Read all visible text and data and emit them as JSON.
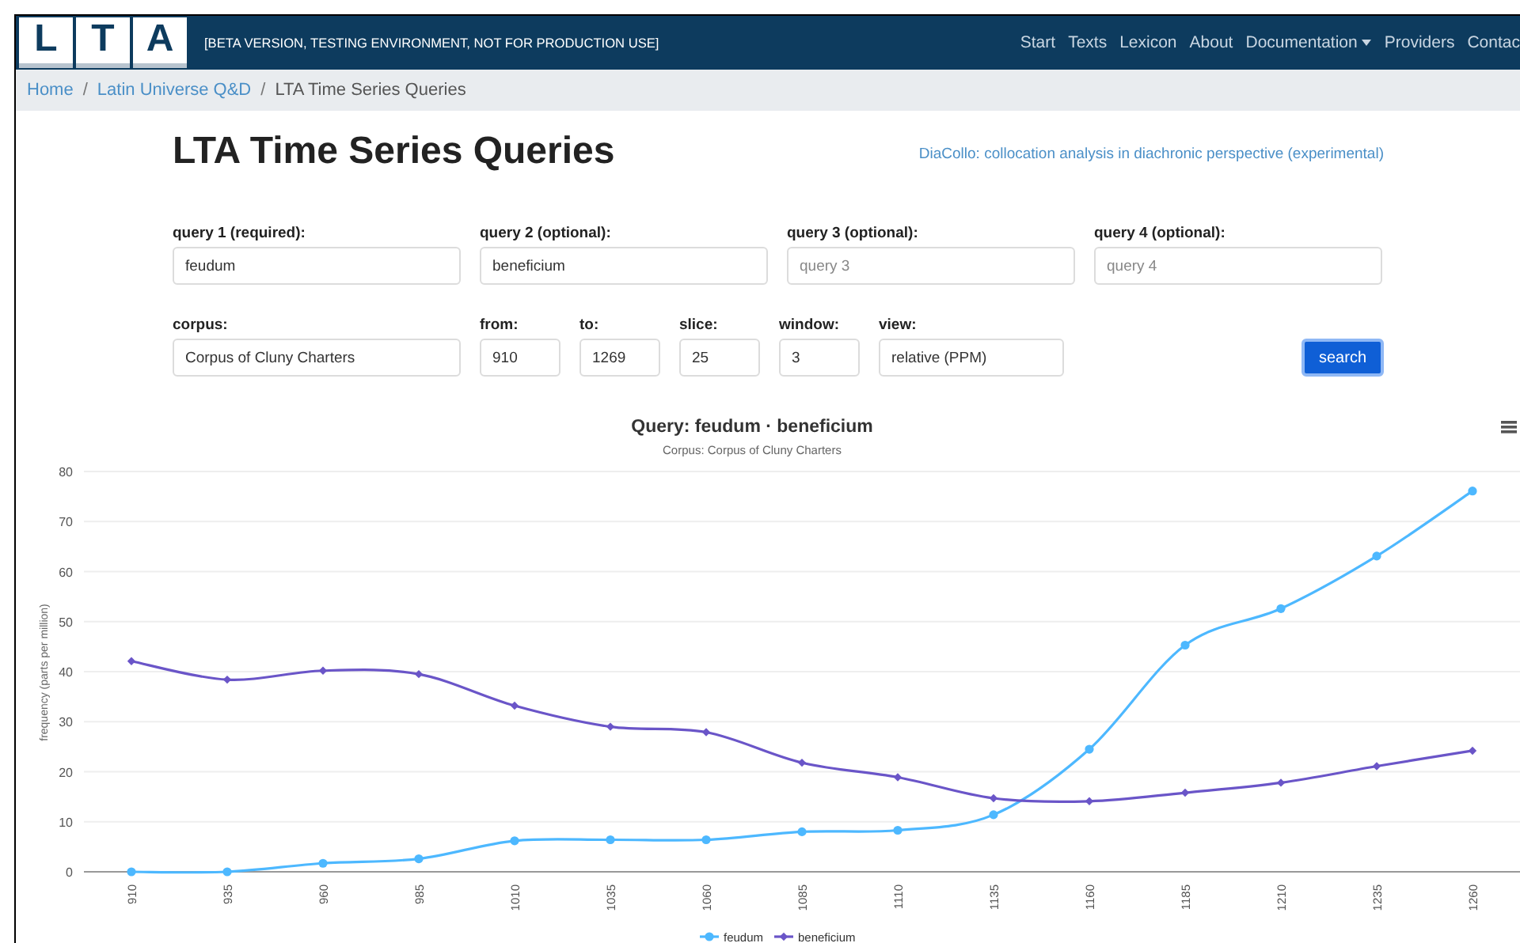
{
  "logo": {
    "letters": [
      "L",
      "T",
      "A"
    ]
  },
  "banner": "[BETA VERSION, TESTING ENVIRONMENT, NOT FOR PRODUCTION USE]",
  "nav": [
    {
      "label": "Start",
      "kind": "link"
    },
    {
      "label": "Texts",
      "kind": "link"
    },
    {
      "label": "Lexicon",
      "kind": "link"
    },
    {
      "label": "About",
      "kind": "link"
    },
    {
      "label": "Documentation",
      "kind": "dropdown"
    },
    {
      "label": "Providers",
      "kind": "link"
    },
    {
      "label": "Contac",
      "kind": "link"
    }
  ],
  "breadcrumb_separator": "/",
  "breadcrumb": [
    {
      "label": "Home",
      "kind": "link"
    },
    {
      "label": "Latin Universe Q&D",
      "kind": "link"
    },
    {
      "label": "LTA Time Series Queries",
      "kind": "current"
    }
  ],
  "title": "LTA Time Series Queries",
  "side_link": "DiaCollo: collocation analysis in diachronic perspective (experimental)",
  "query_fields": [
    {
      "label": "query 1 (required):",
      "value": "feudum"
    },
    {
      "label": "query 2 (optional):",
      "value": "beneficium"
    },
    {
      "label": "query 3 (optional):",
      "placeholder": "query 3"
    },
    {
      "label": "query 4 (optional):",
      "placeholder": "query 4"
    }
  ],
  "option_fields": [
    {
      "label": "corpus:",
      "value": "Corpus of Cluny Charters",
      "kind": "wide"
    },
    {
      "label": "from:",
      "value": "910",
      "kind": "narrow"
    },
    {
      "label": "to:",
      "value": "1269",
      "kind": "narrow"
    },
    {
      "label": "slice:",
      "value": "25",
      "kind": "narrow"
    },
    {
      "label": "window:",
      "value": "3",
      "kind": "narrow"
    },
    {
      "label": "view:",
      "value": "relative (PPM)",
      "kind": "medium"
    }
  ],
  "search_button": "search",
  "chart": {
    "subtitle": "Corpus: Corpus of Cluny Charters",
    "chart_data": {
      "type": "line",
      "grid": true,
      "legend": "bottom",
      "title": "Query: feudum · beneficium",
      "ylabel": "frequency (parts per million)",
      "categories": [
        "910",
        "935",
        "960",
        "985",
        "1010",
        "1035",
        "1060",
        "1085",
        "1110",
        "1135",
        "1160",
        "1185",
        "1210",
        "1235",
        "1260"
      ],
      "ylim": [
        0,
        80
      ],
      "yticks": [
        0,
        10,
        20,
        30,
        40,
        50,
        60,
        70,
        80
      ],
      "series": [
        {
          "name": "feudum",
          "color": "#4db8ff",
          "marker": "circle",
          "values": [
            0,
            0,
            1.7,
            2.6,
            6.2,
            6.4,
            6.4,
            8.0,
            8.3,
            11.4,
            24.5,
            45.3,
            52.6,
            63.1,
            76.1
          ]
        },
        {
          "name": "beneficium",
          "color": "#6a55c8",
          "marker": "diamond",
          "values": [
            42.1,
            38.4,
            40.2,
            39.5,
            33.2,
            29.0,
            27.9,
            21.8,
            18.9,
            14.7,
            14.1,
            15.8,
            17.8,
            21.1,
            24.2
          ]
        }
      ]
    }
  }
}
